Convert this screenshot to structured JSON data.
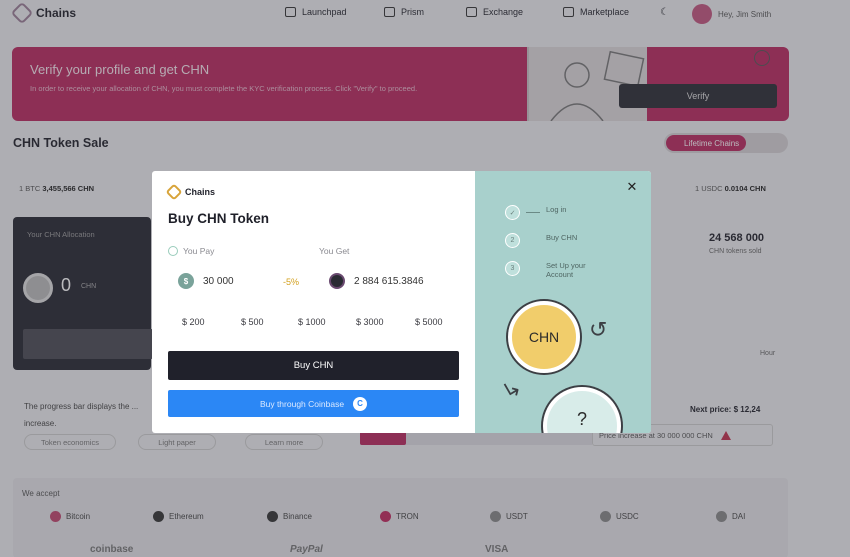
{
  "nav": {
    "brand": "Chains",
    "items": [
      {
        "label": "Launchpad",
        "icon": "rocket-icon"
      },
      {
        "label": "Prism",
        "icon": "prism-icon"
      },
      {
        "label": "Exchange",
        "icon": "exchange-icon"
      },
      {
        "label": "Marketplace",
        "icon": "marketplace-icon"
      }
    ],
    "greeting": "Hey, Jim Smith"
  },
  "banner": {
    "title": "Verify your profile and get CHN",
    "subtitle": "In order to receive your allocation of CHN, you must complete the KYC verification process. Click \"Verify\" to proceed.",
    "button": "Verify"
  },
  "sale": {
    "title": "CHN Token Sale",
    "toggle_label": "Lifetime Chains",
    "stat_left_label": "1 BTC",
    "stat_left_value": "3,455,566 CHN",
    "stat_right_label": "1 USDC",
    "stat_right_value": "0.0104 CHN",
    "allocation_label": "Your CHN Allocation",
    "allocation_value": "0",
    "allocation_unit": "CHN",
    "raised_value": "24 568 000",
    "raised_label": "CHN tokens sold",
    "hour_label": "Hour",
    "progress_note": "The progress bar displays the ... increase.",
    "pills": [
      "Token economics",
      "Light paper",
      "Learn more"
    ],
    "next_price": "Next price: $ 12,24",
    "price_increase": "Price increase at 30 000 000 CHN",
    "progress_fraction": 0.2
  },
  "accept": {
    "title": "We accept",
    "coins": [
      {
        "label": "Bitcoin",
        "color": "#c0456e"
      },
      {
        "label": "Ethereum",
        "color": "#333333"
      },
      {
        "label": "Binance",
        "color": "#333333"
      },
      {
        "label": "TRON",
        "color": "#c0285e"
      },
      {
        "label": "USDT",
        "color": "#888888"
      },
      {
        "label": "USDC",
        "color": "#888888"
      },
      {
        "label": "DAI",
        "color": "#888888"
      }
    ],
    "partners": [
      "coinbase",
      "PayPal",
      "VISA"
    ]
  },
  "modal": {
    "brand": "Chains",
    "title": "Buy CHN Token",
    "you_pay_label": "You Pay",
    "you_get_label": "You Get",
    "pay_value": "30 000",
    "discount": "-5%",
    "get_value": "2 884 615.3846",
    "presets": [
      "$ 200",
      "$ 500",
      "$ 1000",
      "$ 3000",
      "$ 5000"
    ],
    "buy_button": "Buy CHN",
    "coinbase_button": "Buy through Coinbase",
    "steps": [
      "Log in",
      "Buy CHN",
      "Set Up your Account"
    ],
    "coin_label": "CHN",
    "question": "?"
  },
  "colors": {
    "brand": "#b8285e",
    "primary_dark": "#20212b",
    "coinbase_blue": "#2b87f5",
    "mint": "#a8d0cc",
    "gold": "#f1cd6b"
  }
}
